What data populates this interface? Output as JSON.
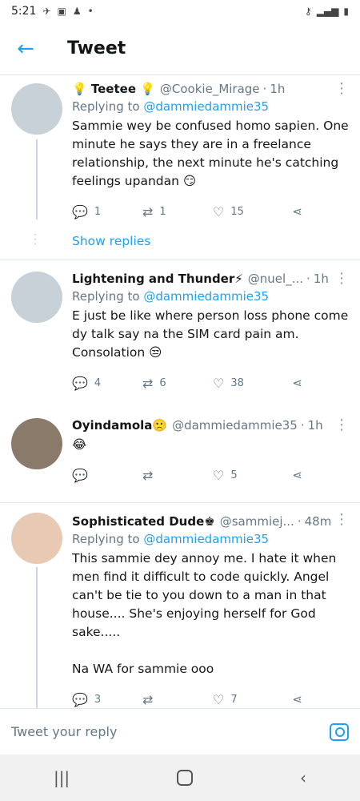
{
  "status": {
    "time": "5:21"
  },
  "header": {
    "title": "Tweet"
  },
  "tweets": [
    {
      "name": "💡 Teetee 💡",
      "handle": "@Cookie_Mirage",
      "time": "1h",
      "reply_prefix": "Replying to ",
      "reply_to": "@dammiedammie35",
      "body": "Sammie wey be confused homo sapien. One minute he says they are in a freelance relationship, the next minute he's catching feelings upandan 😏",
      "replies": "1",
      "retweets": "1",
      "likes": "15",
      "show_replies": "Show replies"
    },
    {
      "name": "Lightening and Thunder⚡",
      "handle": "@nuel_...",
      "time": "1h",
      "reply_prefix": "Replying to ",
      "reply_to": "@dammiedammie35",
      "body": "E just be like where person loss phone come dy talk say na the SIM card pain am. Consolation 😒",
      "replies": "4",
      "retweets": "6",
      "likes": "38"
    },
    {
      "name": "Oyindamola🙁",
      "handle": "@dammiedammie35",
      "time": "1h",
      "body": "😂",
      "replies": "",
      "retweets": "",
      "likes": "5"
    },
    {
      "name": "Sophisticated Dude♚",
      "handle": "@sammiej...",
      "time": "48m",
      "reply_prefix": "Replying to ",
      "reply_to": "@dammiedammie35",
      "body": "This sammie dey annoy me. I hate it when men find it difficult to code quickly. Angel can't be tie to you down to a man in that house.... She's enjoying herself for God sake.....\n\nNa WA for sammie ooo",
      "replies": "3",
      "retweets": "",
      "likes": "7"
    }
  ],
  "reply_bar": {
    "placeholder": "Tweet your reply"
  },
  "icons": {
    "back": "arrow-left-icon",
    "reply": "comment-icon",
    "retweet": "retweet-icon",
    "like": "heart-icon",
    "share": "share-icon",
    "camera": "camera-icon"
  },
  "colors": {
    "accent": "#1da1f2",
    "muted": "#657786",
    "text": "#14171a"
  }
}
